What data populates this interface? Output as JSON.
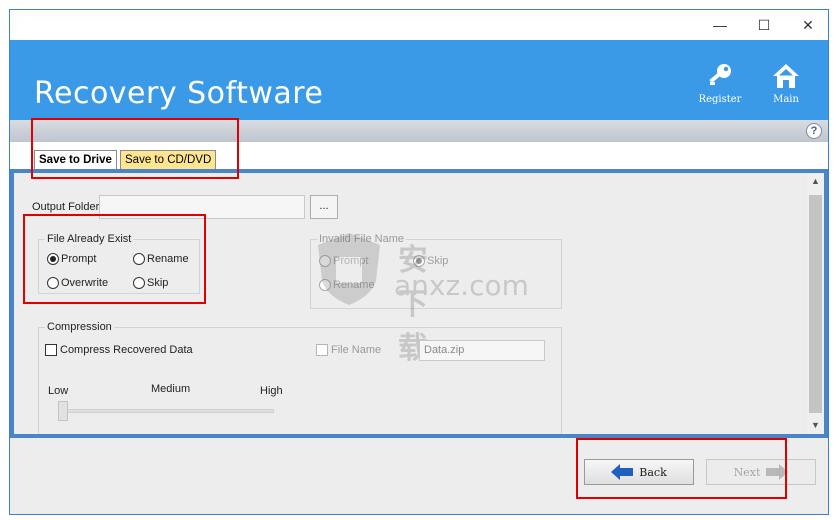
{
  "app": {
    "title": "Recovery Software",
    "accent": "#3b9ae8"
  },
  "window_controls": {
    "minimize": "—",
    "maximize": "☐",
    "close": "✕"
  },
  "nav": {
    "register_label": "Register",
    "register_icon": "key-icon",
    "main_label": "Main",
    "main_icon": "home-icon"
  },
  "help_icon": "?",
  "tabs": [
    {
      "label": "Save to Drive",
      "active": true
    },
    {
      "label": "Save to CD/DVD",
      "active": false
    }
  ],
  "output_folder": {
    "label": "Output Folder",
    "value": "",
    "browse_label": "..."
  },
  "file_already_exist": {
    "title": "File Already Exist",
    "options": [
      {
        "label": "Prompt",
        "selected": true
      },
      {
        "label": "Rename",
        "selected": false
      },
      {
        "label": "Overwrite",
        "selected": false
      },
      {
        "label": "Skip",
        "selected": false
      }
    ]
  },
  "invalid_file_name": {
    "title": "Invalid File Name",
    "options": [
      {
        "label": "Prompt",
        "selected": false
      },
      {
        "label": "Skip",
        "selected": true
      },
      {
        "label": "Rename",
        "selected": false
      }
    ]
  },
  "compression": {
    "title": "Compression",
    "compress_label": "Compress Recovered Data",
    "compress_checked": false,
    "filename_label": "File Name",
    "filename_value": "Data.zip",
    "levels": [
      "Low",
      "Medium",
      "High"
    ],
    "level_value": 0
  },
  "watermark": {
    "line1": "安下载",
    "line2": "anxz.com"
  },
  "footer": {
    "back_label": "Back",
    "next_label": "Next"
  }
}
